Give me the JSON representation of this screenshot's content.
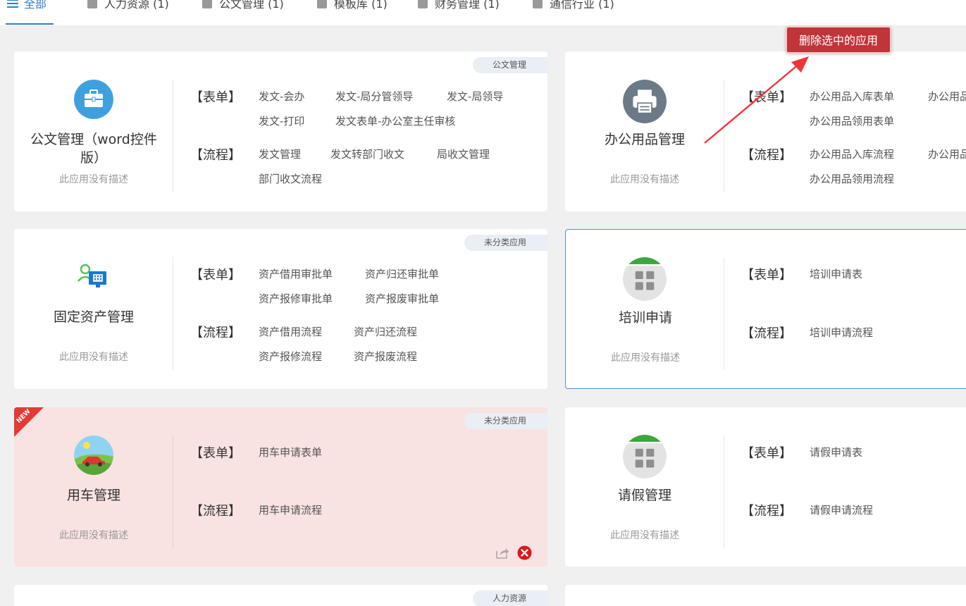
{
  "tabs": [
    {
      "label": "全部",
      "active": true
    },
    {
      "label": "人力资源 (1)"
    },
    {
      "label": "公文管理 (1)"
    },
    {
      "label": "模板库 (1)"
    },
    {
      "label": "财务管理 (1)"
    },
    {
      "label": "通信行业 (1)"
    }
  ],
  "delete_button": "删除选中的应用",
  "labels": {
    "form": "【表单】",
    "flow": "【流程】"
  },
  "cards": [
    {
      "badge": "公文管理",
      "name": "公文管理（word控件版）",
      "desc": "此应用没有描述",
      "forms": [
        "发文-会办",
        "发文-局分管领导",
        "发文-局领导",
        "发文-打印",
        "发文表单-办公室主任审核"
      ],
      "flows": [
        "发文管理",
        "发文转部门收文",
        "局收文管理",
        "部门收文流程"
      ]
    },
    {
      "name": "办公用品管理",
      "desc": "此应用没有描述",
      "forms": [
        "办公用品入库表单",
        "办公用品",
        "办公用品领用表单"
      ],
      "flows": [
        "办公用品入库流程",
        "办公用品",
        "办公用品领用流程"
      ]
    },
    {
      "badge": "未分类应用",
      "name": "固定资产管理",
      "desc": "此应用没有描述",
      "forms": [
        "资产借用审批单",
        "资产归还审批单",
        "资产报修审批单",
        "资产报废审批单"
      ],
      "flows": [
        "资产借用流程",
        "资产归还流程",
        "资产报修流程",
        "资产报废流程"
      ]
    },
    {
      "name": "培训申请",
      "desc": "此应用没有描述",
      "forms": [
        "培训申请表"
      ],
      "flows": [
        "培训申请流程"
      ]
    },
    {
      "badge": "未分类应用",
      "ribbon": "NEW",
      "name": "用车管理",
      "desc": "此应用没有描述",
      "forms": [
        "用车申请表单"
      ],
      "flows": [
        "用车申请流程"
      ]
    },
    {
      "name": "请假管理",
      "desc": "此应用没有描述",
      "forms": [
        "请假申请表"
      ],
      "flows": [
        "请假申请流程"
      ]
    },
    {
      "badge": "人力资源"
    }
  ],
  "colors": {
    "accent": "#2f7ec9",
    "danger": "#c0343a",
    "selected_card_bg": "#f9e2e2",
    "badge_bg": "#eaeef5"
  },
  "icons": [
    "list-icon",
    "briefcase-icon",
    "printer-icon",
    "asset-computer-icon",
    "app-grid-icon",
    "car-landscape-icon",
    "share-icon",
    "delete-icon"
  ]
}
